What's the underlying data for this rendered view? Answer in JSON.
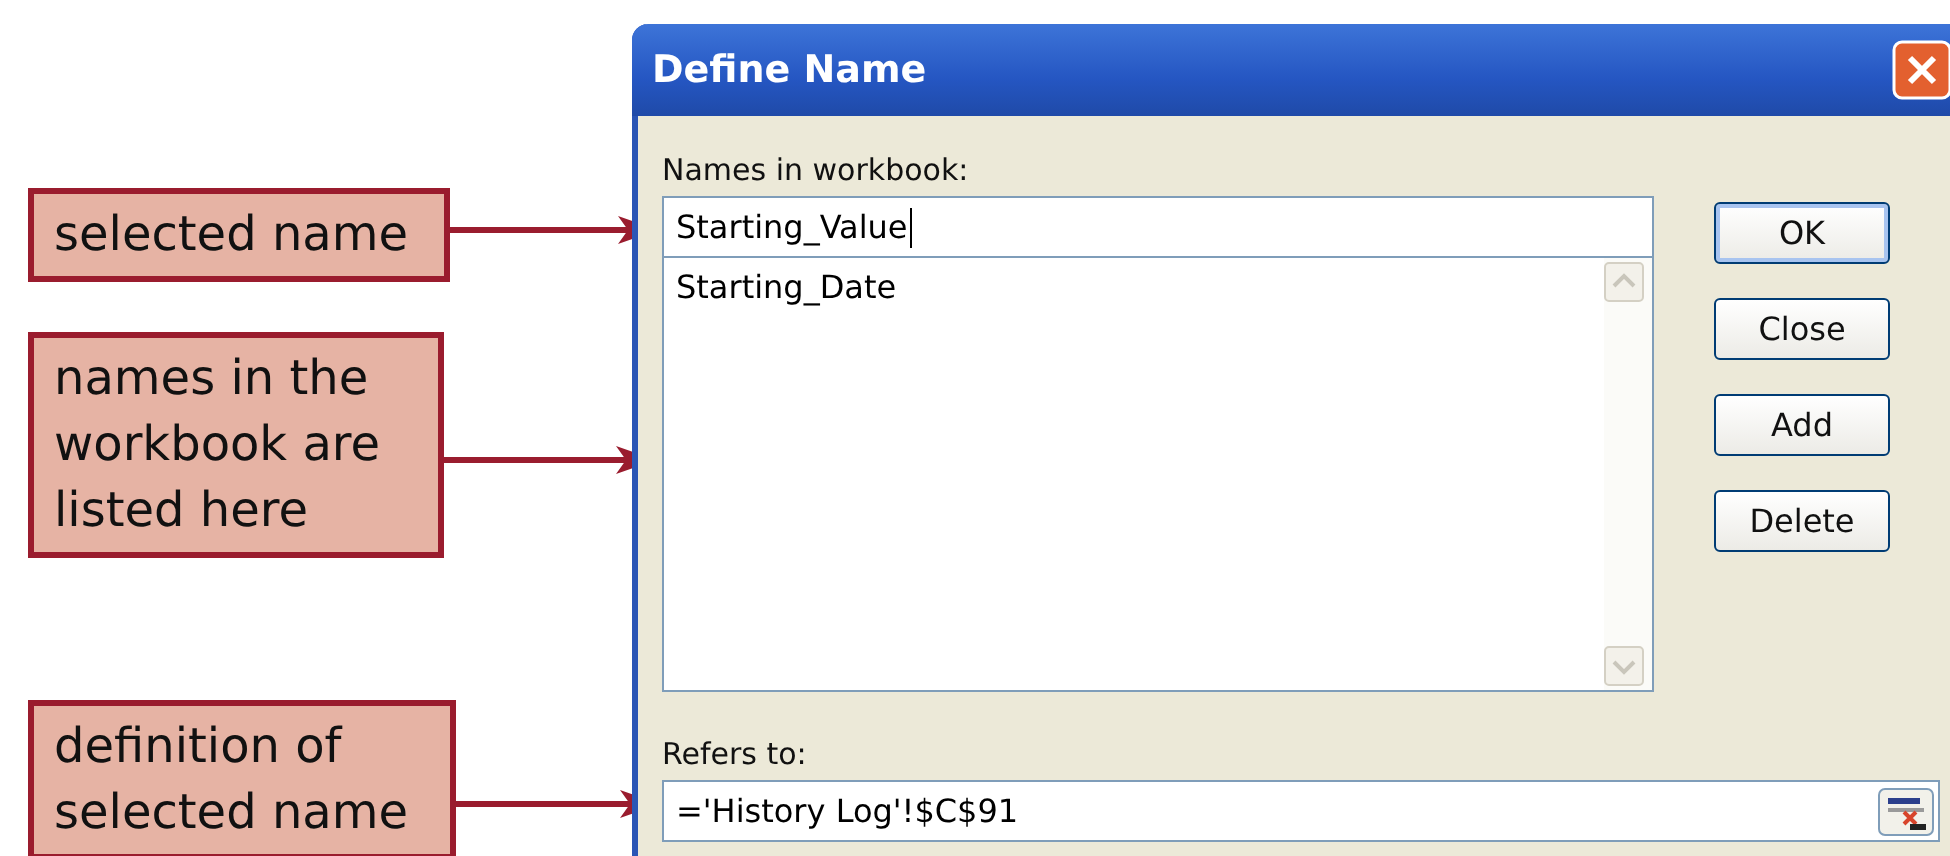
{
  "callouts": [
    {
      "text": "selected name"
    },
    {
      "text": "names in the workbook are listed here"
    },
    {
      "text": "definition of selected name"
    }
  ],
  "dialog": {
    "title": "Define Name",
    "names_label": "Names in workbook:",
    "name_value": "Starting_Value",
    "names_list": [
      "Starting_Date"
    ],
    "refers_label": "Refers to:",
    "refers_value": "='History Log'!$C$91",
    "buttons": [
      {
        "label": "OK",
        "default": true
      },
      {
        "label": "Close",
        "default": false
      },
      {
        "label": "Add",
        "default": false
      },
      {
        "label": "Delete",
        "default": false
      }
    ]
  }
}
